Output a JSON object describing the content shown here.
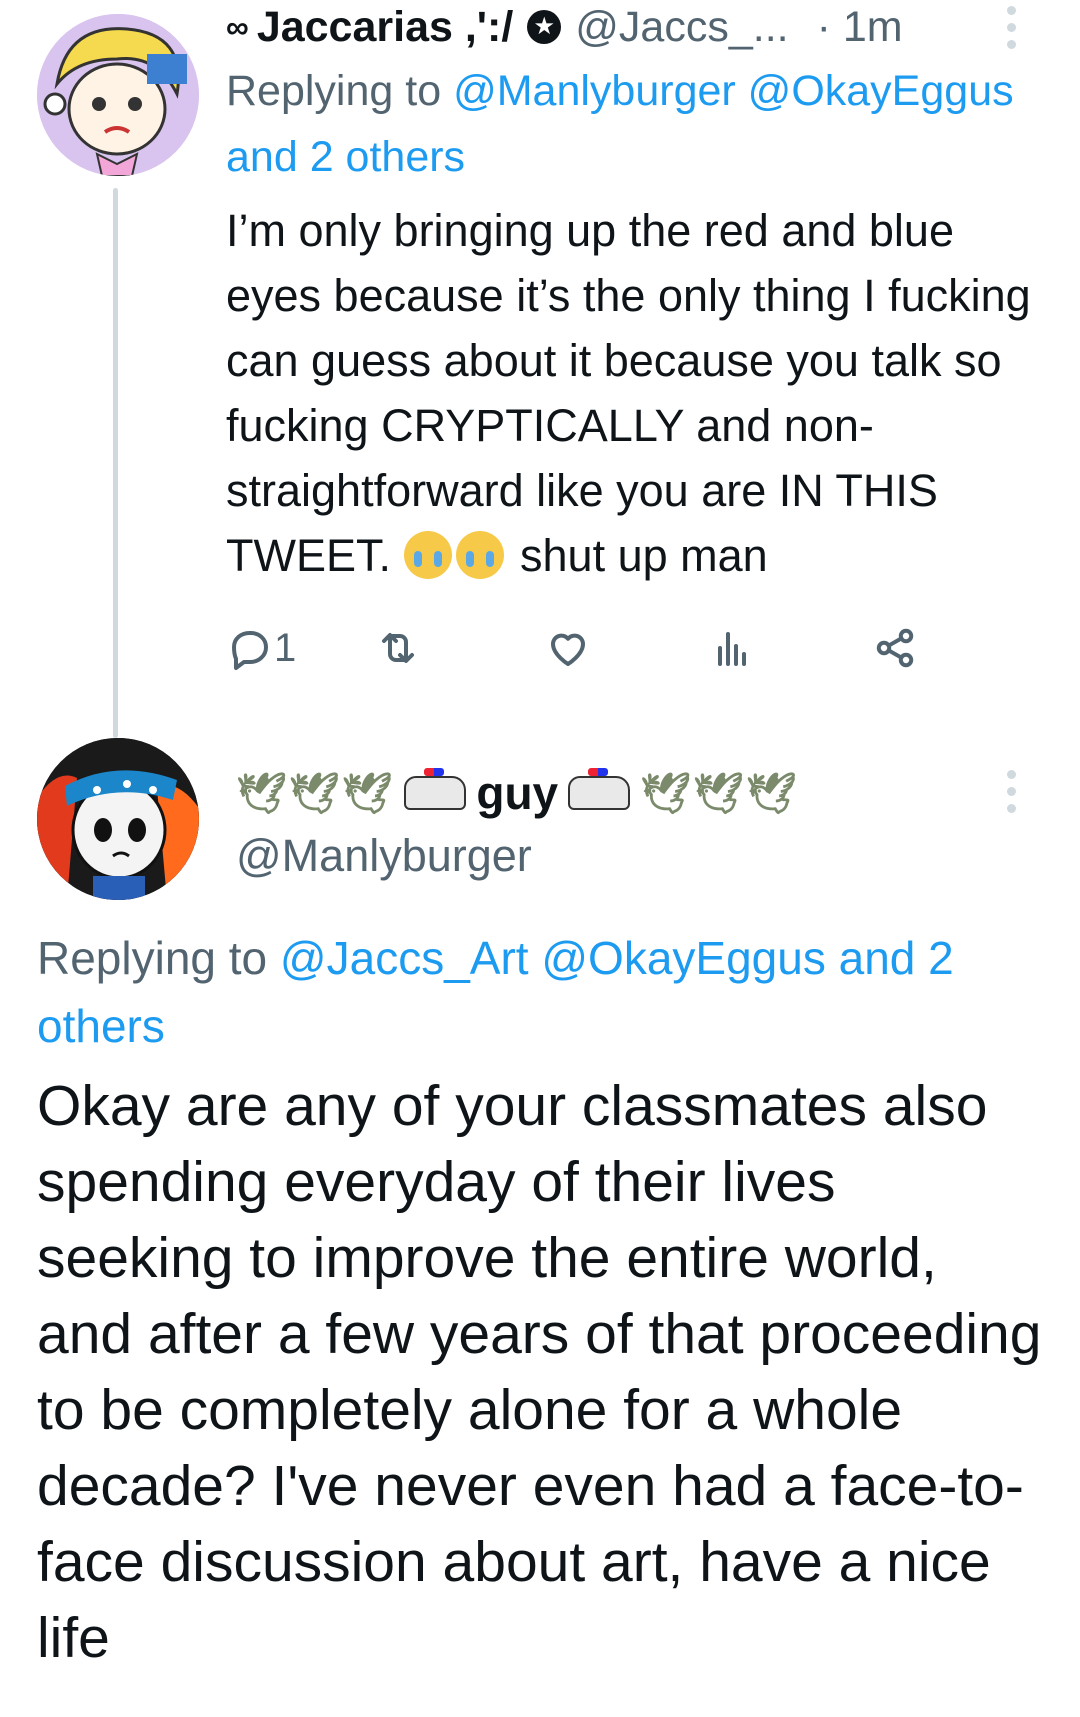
{
  "tweet1": {
    "name_prefix": "∞",
    "name": "Jaccarias ,':/",
    "handle": "@Jaccs_...",
    "time": "· 1m",
    "replying_prefix": "Replying to ",
    "replying_to": "@Manlyburger @OkayEggus and 2 others",
    "body_main": "I’m only bringing up the red and blue eyes because it’s the only thing I fucking can guess about it because you talk so fucking CRYPTICALLY and non-straightforward like you are IN THIS TWEET.",
    "body_after_emoji": " shut up man",
    "emojis": [
      "loudly-crying-face",
      "loudly-crying-face"
    ],
    "actions": {
      "reply_count": "1",
      "retweet_count": "",
      "like_count": "",
      "views_count": ""
    }
  },
  "tweet2": {
    "name": "guy",
    "handle": "@Manlyburger",
    "decorations": [
      "dove",
      "dove",
      "dove",
      "police-car",
      "police-car",
      "dove",
      "dove",
      "dove"
    ],
    "replying_prefix": "Replying to ",
    "replying_to": "@Jaccs_Art @OkayEggus and 2 others",
    "body": "Okay are any of your classmates also spending everyday of their lives seeking to improve the entire world, and after a few years of that proceeding to be completely alone for a whole decade? I've never even had a face-to-face discussion about art, have a nice life"
  },
  "colors": {
    "link": "#1d9bf0",
    "secondary_text": "#536471",
    "text": "#0f1419",
    "thread_line": "#cfd9de"
  },
  "icons": [
    "reply-icon",
    "retweet-icon",
    "like-icon",
    "views-icon",
    "share-icon",
    "more-icon",
    "verified-icon"
  ]
}
